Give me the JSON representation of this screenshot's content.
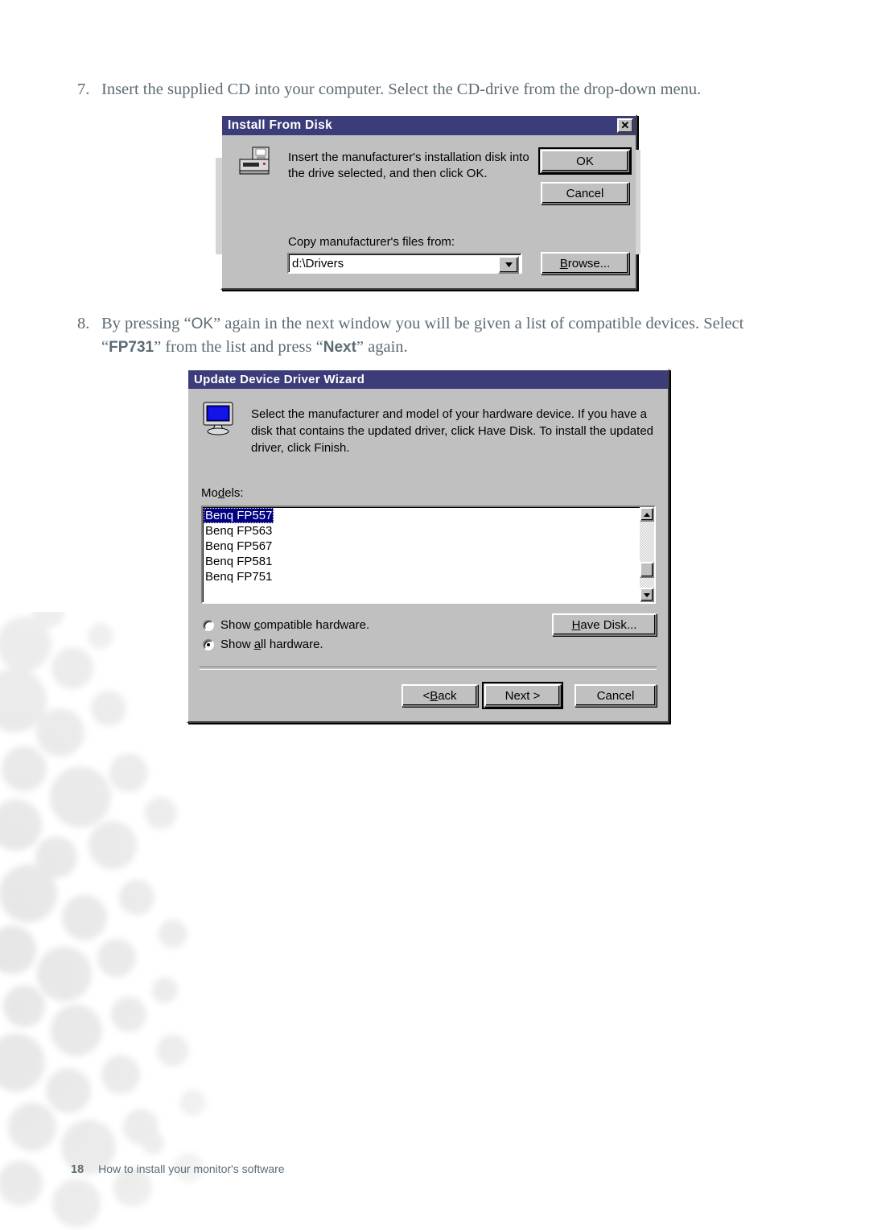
{
  "page": {
    "footer_page_number": "18",
    "footer_title": "How to install your monitor's software",
    "text_color": "#5c6b74"
  },
  "steps": [
    {
      "number": "7.",
      "text": "Insert the supplied CD into your computer. Select the CD-drive from the drop-down menu."
    },
    {
      "number": "8.",
      "part1": "By pressing “",
      "ok": "OK",
      "part2": "” again in the next window you will be given a list of compatible devices. Select “",
      "model": "FP731",
      "part3": "” from the list and press “",
      "next": "Next",
      "part4": "” again."
    }
  ],
  "install_dialog": {
    "title": "Install From Disk",
    "close_label": "✕",
    "description": "Insert the manufacturer's installation disk into the drive selected, and then click OK.",
    "copy_from_label": "Copy manufacturer's files from:",
    "path_value": "d:\\Drivers",
    "dropdown_arrow": "▼",
    "ok_label": "OK",
    "cancel_label": "Cancel",
    "browse_label": "Browse...",
    "browse_accel": "B",
    "titlebar_color": "#3c3c7a",
    "face_color": "#c0c0c0"
  },
  "wizard_dialog": {
    "title": "Update Device Driver Wizard",
    "description": "Select the manufacturer and model of your hardware device. If you have a disk that contains the updated driver, click Have Disk. To install the updated driver, click Finish.",
    "models_label": "Models:",
    "models_accel": "d",
    "models": [
      {
        "label": "Benq FP557",
        "selected": true
      },
      {
        "label": "Benq FP563",
        "selected": false
      },
      {
        "label": "Benq FP567",
        "selected": false
      },
      {
        "label": "Benq FP581",
        "selected": false
      },
      {
        "label": "Benq FP751",
        "selected": false
      }
    ],
    "scroll_up": "▲",
    "scroll_down": "▼",
    "radio_compatible": {
      "pre": "Show ",
      "accel": "c",
      "post": "ompatible hardware.",
      "selected": false
    },
    "radio_all": {
      "pre": "Show ",
      "accel": "a",
      "post": "ll hardware.",
      "selected": true
    },
    "have_disk_accel": "H",
    "have_disk_post": "ave Disk...",
    "back_label_pre": "< ",
    "back_accel": "B",
    "back_label_post": "ack",
    "next_label": "Next >",
    "cancel_label": "Cancel",
    "titlebar_color": "#3c3c7a",
    "selection_color": "#000080"
  }
}
